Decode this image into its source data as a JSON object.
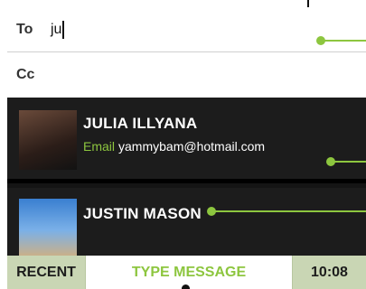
{
  "compose": {
    "to_label": "To",
    "to_value": "ju",
    "cc_label": "Cc"
  },
  "contacts": [
    {
      "name": "JULIA ILLYANA",
      "detail_label": "Email",
      "detail_value": "yammybam@hotmail.com"
    },
    {
      "name": "JUSTIN MASON"
    }
  ],
  "bottom_bar": {
    "recent_label": "RECENT",
    "type_message_label": "TYPE MESSAGE",
    "time": "10:08"
  },
  "colors": {
    "accent": "#8dc63f",
    "list_background": "#1c1c1c",
    "bar_background": "#c9d6b4"
  }
}
